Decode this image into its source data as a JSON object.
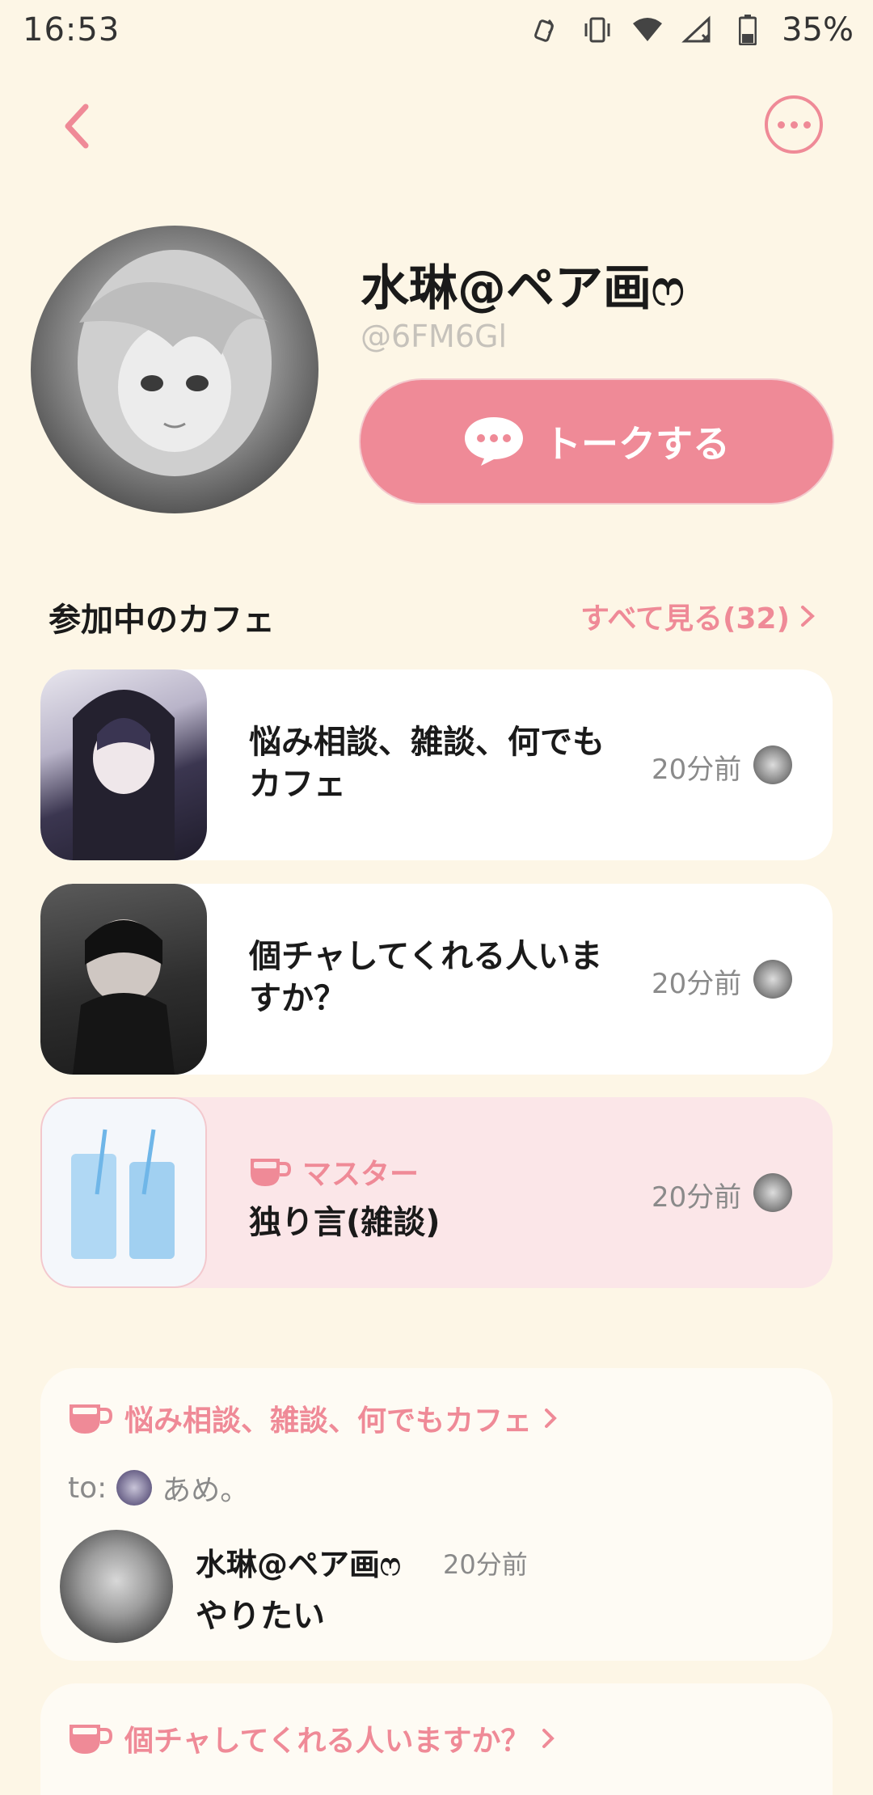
{
  "status_bar": {
    "time": "16:53",
    "battery": "35%"
  },
  "header": {
    "back_icon": "chevron-left-icon",
    "more_icon": "more-horizontal-icon"
  },
  "profile": {
    "name": "水琳@ペア画ෆ",
    "handle": "@6FM6Gl",
    "talk_button": "トークする"
  },
  "cafes": {
    "heading": "参加中のカフェ",
    "see_all": "すべて見る(32)",
    "items": [
      {
        "title": "悩み相談、雑談、何でもカフェ",
        "time": "20分前"
      },
      {
        "title": "個チャしてくれる人いますか？",
        "time": "20分前"
      },
      {
        "badge": "マスター",
        "title": "独り言(雑談)",
        "time": "20分前"
      }
    ]
  },
  "posts": [
    {
      "cafe": "悩み相談、雑談、何でもカフェ",
      "to_label": "to:",
      "to_name": "あめ。",
      "author": "水琳@ペア画ෆ",
      "time": "20分前",
      "body": "やりたい"
    },
    {
      "cafe": "個チャしてくれる人いますか？"
    }
  ],
  "colors": {
    "accent": "#ef8a97",
    "background": "#fdf6e6",
    "card": "#ffffff",
    "master_card": "#fbe6e8"
  }
}
